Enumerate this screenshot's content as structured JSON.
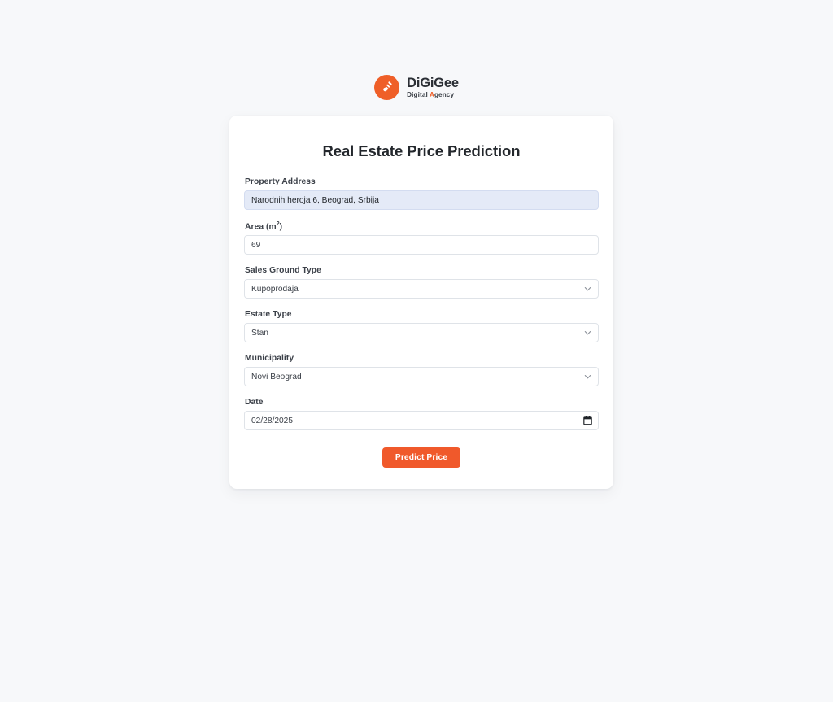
{
  "brand": {
    "mark_icon": "shovel-icon",
    "name": "DiGiGee",
    "tagline_prefix": "Digital ",
    "tagline_accent": "A",
    "tagline_suffix": "gency",
    "accent_color": "#ef5f28"
  },
  "card": {
    "title": "Real Estate Price Prediction"
  },
  "form": {
    "fields": [
      {
        "key": "property_address",
        "label": "Property Address",
        "type": "text",
        "value": "Narodnih heroja 6, Beograd, Srbija",
        "placeholder": "",
        "autofilled": true,
        "autofill_color": "#e4eaf7"
      },
      {
        "key": "area",
        "label_text": "Area (m",
        "label_sup": "2",
        "label_suffix": ")",
        "label": "Area (m²)",
        "type": "number",
        "value": "69",
        "placeholder": "",
        "autofilled": false
      },
      {
        "key": "sales_ground_type",
        "label": "Sales Ground Type",
        "type": "select",
        "value": "Kupoprodaja",
        "icon": "chevron-down-icon"
      },
      {
        "key": "estate_type",
        "label": "Estate Type",
        "type": "select",
        "value": "Stan",
        "icon": "chevron-down-icon"
      },
      {
        "key": "municipality",
        "label": "Municipality",
        "type": "select",
        "value": "Novi Beograd",
        "icon": "chevron-down-icon"
      },
      {
        "key": "date",
        "label": "Date",
        "type": "date",
        "value": "02/28/2025",
        "icon": "calendar-icon"
      }
    ],
    "submit": {
      "label": "Predict Price",
      "color": "#f0592b"
    }
  },
  "page": {
    "background_color": "#f7f8fa",
    "card_background": "#ffffff"
  }
}
